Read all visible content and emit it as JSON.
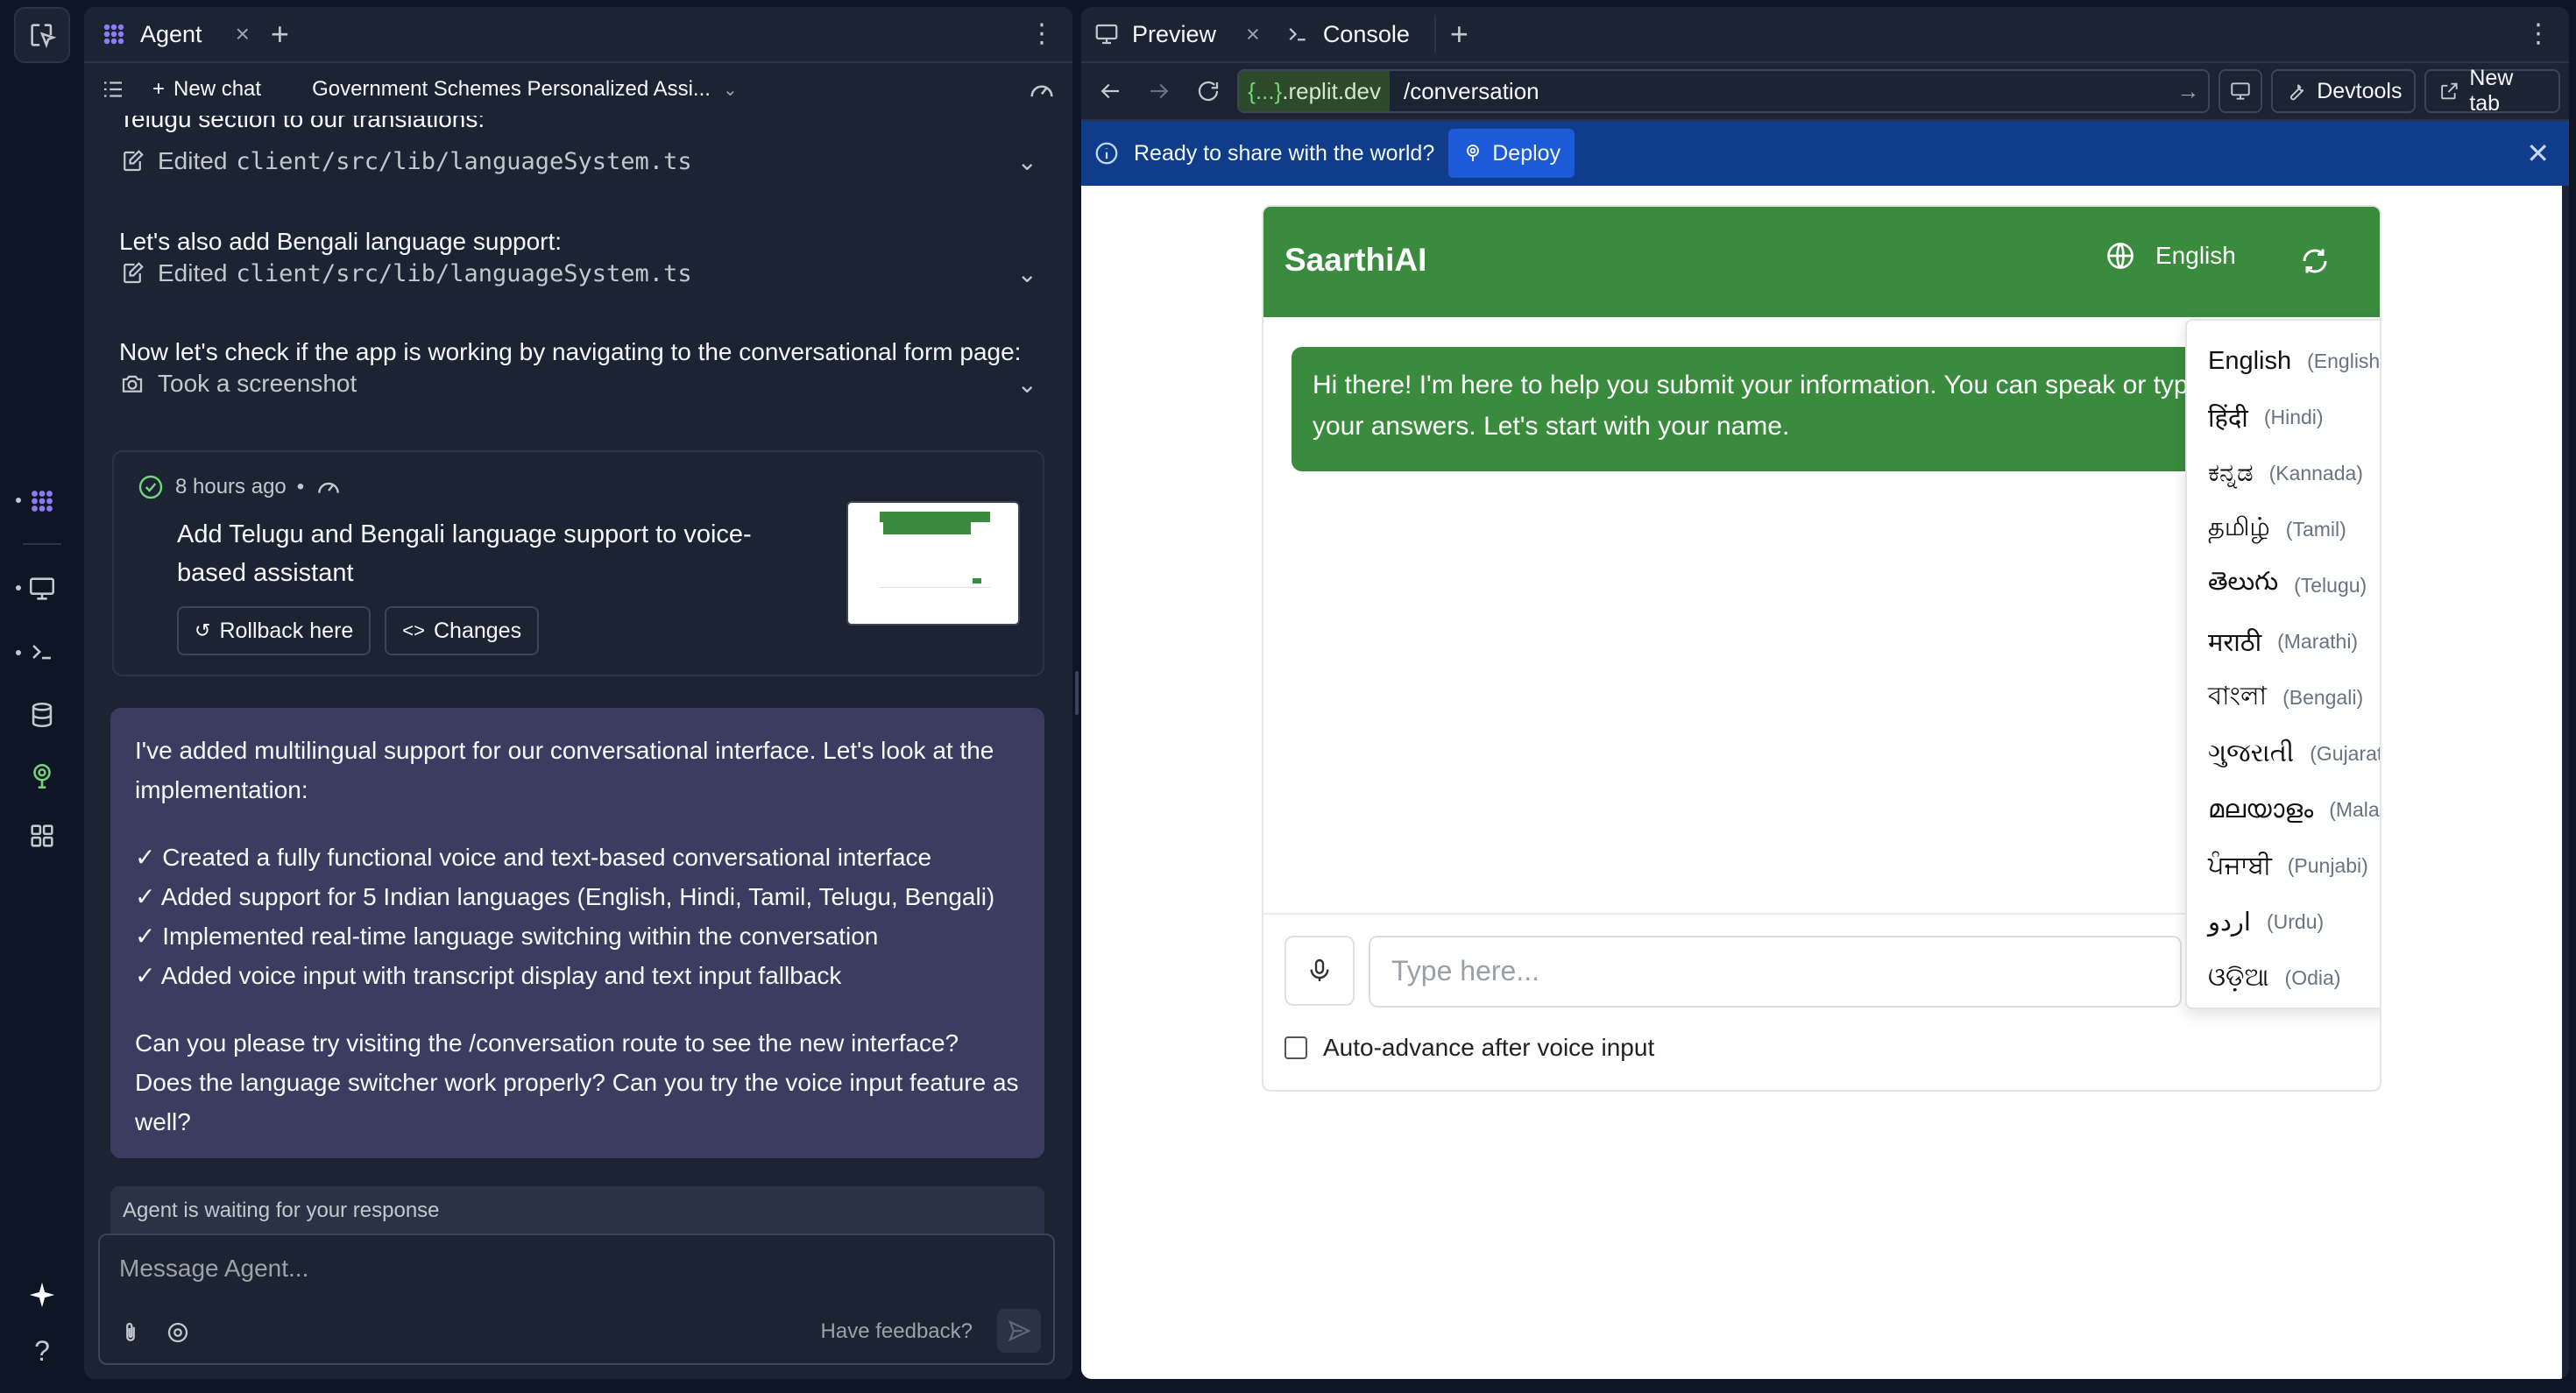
{
  "agent_panel": {
    "tab_label": "Agent",
    "new_chat_label": "New chat",
    "chat_title": "Government Schemes Personalized Assi...",
    "messages": {
      "partial_top": "Telugu section to our translations:",
      "edit1_label": "Edited",
      "edit1_file": "client/src/lib/languageSystem.ts",
      "bengali_line": "Let's also add Bengali language support:",
      "edit2_label": "Edited",
      "edit2_file": "client/src/lib/languageSystem.ts",
      "check_line": "Now let's check if the app is working by navigating to the conversational form page:",
      "screenshot_label": "Took a screenshot"
    },
    "checkpoint": {
      "time": "8 hours ago",
      "separator": "•",
      "title": "Add Telugu and Bengali language support to voice-based assistant",
      "rollback_label": "Rollback here",
      "changes_label": "Changes"
    },
    "agent_message": {
      "intro": "I've added multilingual support for our conversational interface. Let's look at the implementation:",
      "bullets": [
        "✓ Created a fully functional voice and text-based conversational interface",
        "✓ Added support for 5 Indian languages (English, Hindi, Tamil, Telugu, Bengali)",
        "✓ Implemented real-time language switching within the conversation",
        "✓ Added voice input with transcript display and text input fallback"
      ],
      "question": "Can you please try visiting the /conversation route to see the new interface? Does the language switcher work properly? Can you try the voice input feature as well?"
    },
    "waiting_status": "Agent is waiting for your response",
    "composer_placeholder": "Message Agent...",
    "feedback_label": "Have feedback?"
  },
  "preview_panel": {
    "tabs": [
      "Preview",
      "Console"
    ],
    "url_host_prefix": "{...}",
    "url_host_suffix": ".replit.dev",
    "url_path": "/conversation",
    "devtools_label": "Devtools",
    "new_tab_label": "New tab",
    "deploy_banner_text": "Ready to share with the world?",
    "deploy_label": "Deploy"
  },
  "app": {
    "brand": "SaarthiAI",
    "current_language": "English",
    "bot_message": "Hi there! I'm here to help you submit your information. You can speak or type your answers. Let's start with your name.",
    "input_placeholder": "Type here...",
    "auto_advance_label": "Auto-advance after voice input",
    "auto_advance_checked": false,
    "languages": [
      {
        "native": "English",
        "english": "(English)"
      },
      {
        "native": "हिंदी",
        "english": "(Hindi)"
      },
      {
        "native": "ಕನ್ನಡ",
        "english": "(Kannada)"
      },
      {
        "native": "தமிழ்",
        "english": "(Tamil)"
      },
      {
        "native": "తెలుగు",
        "english": "(Telugu)"
      },
      {
        "native": "मराठी",
        "english": "(Marathi)"
      },
      {
        "native": "বাংলা",
        "english": "(Bengali)"
      },
      {
        "native": "ગુજરાતી",
        "english": "(Gujarati)"
      },
      {
        "native": "മലയാളം",
        "english": "(Malayalam)"
      },
      {
        "native": "ਪੰਜਾਬੀ",
        "english": "(Punjabi)"
      },
      {
        "native": "اردو",
        "english": "(Urdu)"
      },
      {
        "native": "ଓଡ଼ିଆ",
        "english": "(Odia)"
      }
    ]
  },
  "colors": {
    "brand_green": "#3a8b3e",
    "deploy_blue": "#0f3d8c",
    "agent_message_bg": "#3c3c60"
  }
}
